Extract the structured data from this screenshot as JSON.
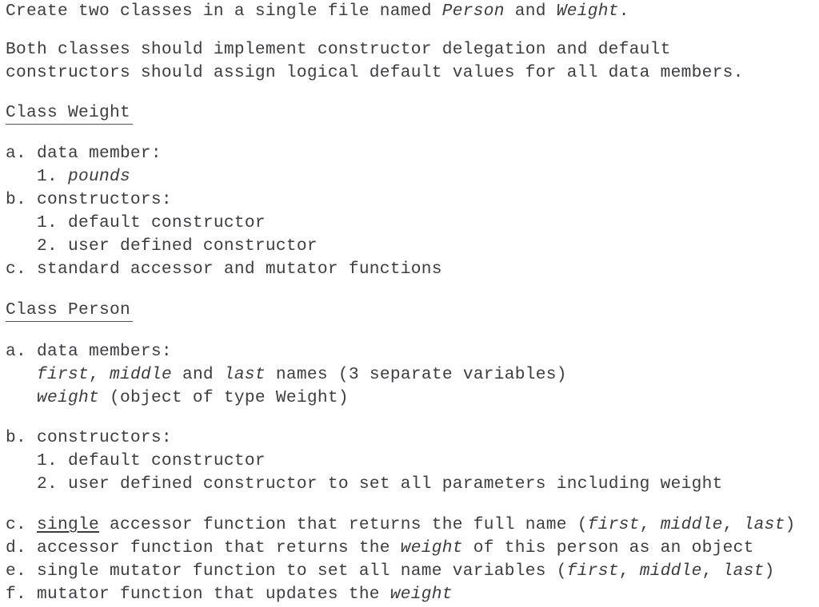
{
  "document": {
    "kind": "assignment-specification",
    "text_color": "#3c3c46",
    "background_color": "#ffffff",
    "intro": {
      "line1_parts": [
        {
          "text": "Create two classes in a single file named ",
          "style": "normal"
        },
        {
          "text": "Person",
          "style": "italic"
        },
        {
          "text": " and ",
          "style": "normal"
        },
        {
          "text": "Weight",
          "style": "italic"
        },
        {
          "text": ".",
          "style": "normal"
        }
      ],
      "line2": "Both classes should implement constructor delegation and default",
      "line3": "constructors should assign logical default values for all data members."
    },
    "sections": [
      {
        "heading": "Class Weight",
        "items": [
          {
            "label": "a.",
            "text": "data member:",
            "indent": 0
          },
          {
            "label": "1.",
            "text": "pounds",
            "indent": 3,
            "style": "italic"
          },
          {
            "label": "b.",
            "text": "constructors:",
            "indent": 0
          },
          {
            "label": "1.",
            "text": "default constructor",
            "indent": 3
          },
          {
            "label": "2.",
            "text": "user defined constructor",
            "indent": 3
          },
          {
            "label": "c.",
            "text": "standard accessor and mutator functions",
            "indent": 0
          }
        ]
      },
      {
        "heading": "Class Person",
        "items": [
          {
            "label": "a.",
            "text": "data members:",
            "indent": 0
          },
          {
            "label": "",
            "text": "first, middle and last names (3 separate variables)",
            "indent": 3
          },
          {
            "label": "",
            "text": "weight (object of type Weight)",
            "indent": 3
          },
          {
            "label": "b.",
            "text": "constructors:",
            "indent": 0
          },
          {
            "label": "1.",
            "text": "default constructor",
            "indent": 3
          },
          {
            "label": "2.",
            "text": "user defined constructor to set all parameters including weight",
            "indent": 3
          },
          {
            "label": "c.",
            "text": "single accessor function that returns the full name (first, middle, last)",
            "indent": 0
          },
          {
            "label": "d.",
            "text": "accessor function that returns the weight of this person as an object",
            "indent": 0
          },
          {
            "label": "e.",
            "text": "single mutator function to set all name variables (first, middle, last)",
            "indent": 0
          },
          {
            "label": "f.",
            "text": "mutator function that updates the weight",
            "indent": 0
          }
        ]
      }
    ],
    "lines": {
      "l1_a": "Create two classes in a single file named ",
      "l1_person": "Person",
      "l1_and": " and ",
      "l1_weight": "Weight",
      "l1_dot": ".",
      "l2": "Both classes should implement constructor delegation and default",
      "l3": "constructors should assign logical default values for all data members.",
      "h1": "Class Weight",
      "w_a": "a. data member:",
      "w_a1_num": "1. ",
      "w_a1_pounds": "pounds",
      "w_b": "b. constructors:",
      "w_b1": "1. default constructor",
      "w_b2": "2. user defined constructor",
      "w_c": "c. standard accessor and mutator functions",
      "h2": "Class Person",
      "p_a": "a. data members:",
      "p_a1_first": "first",
      "p_a1_comma": ", ",
      "p_a1_middle": "middle",
      "p_a1_and": " and ",
      "p_a1_last": "last",
      "p_a1_rest": " names (3 separate variables)",
      "p_a2_weight": "weight",
      "p_a2_rest": " (object of type Weight)",
      "p_b": "b. constructors:",
      "p_b1": "1. default constructor",
      "p_b2": "2. user defined constructor to set all parameters including weight",
      "p_c_label": "c. ",
      "p_c_single": "single",
      "p_c_mid": " accessor function that returns the full name (",
      "p_c_first": "first",
      "p_c_sep1": ", ",
      "p_c_middle": "middle",
      "p_c_sep2": ", ",
      "p_c_last": "last",
      "p_c_end": ")",
      "p_d_pre": "d. accessor function that returns the ",
      "p_d_weight": "weight",
      "p_d_post": " of this person as an object",
      "p_e_pre": "e. single mutator function to set all name variables (",
      "p_e_first": "first",
      "p_e_sep1": ", ",
      "p_e_middle": "middle",
      "p_e_sep2": ", ",
      "p_e_last": "last",
      "p_e_end": ")",
      "p_f_pre": "f. mutator function that updates the ",
      "p_f_weight": "weight"
    }
  }
}
